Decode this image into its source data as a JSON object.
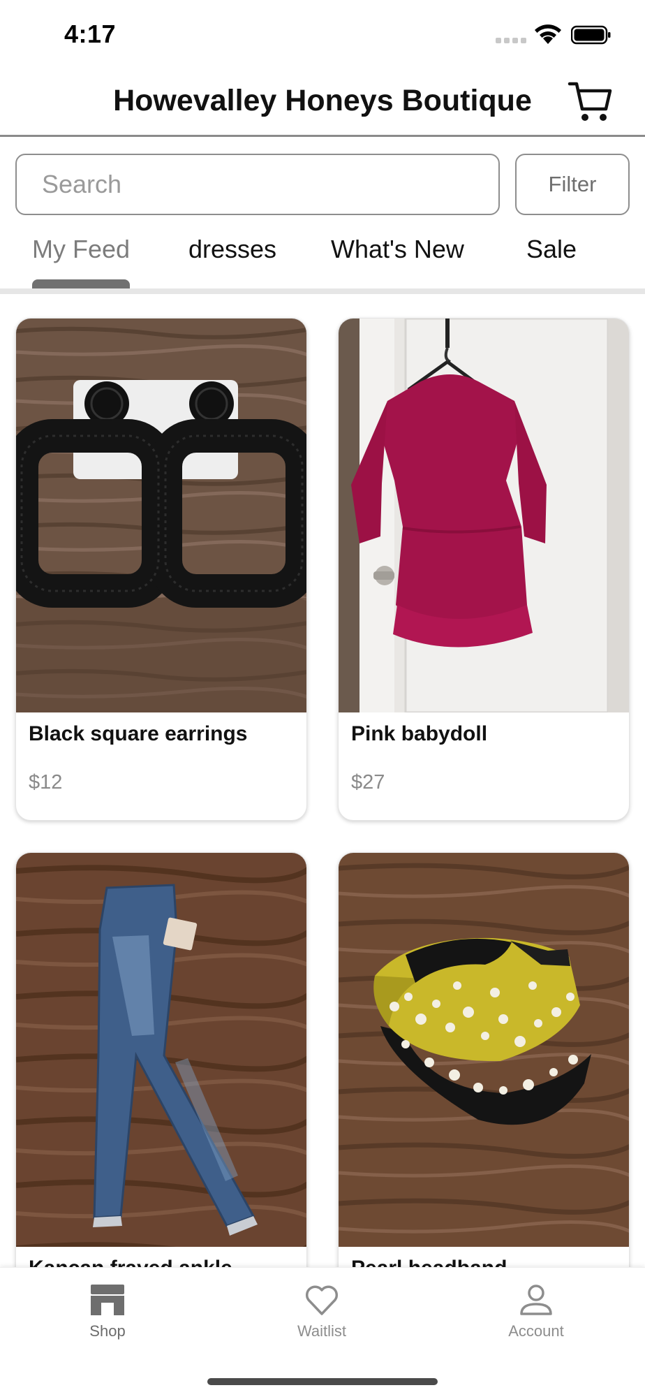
{
  "status": {
    "time": "4:17"
  },
  "header": {
    "title": "Howevalley Honeys Boutique",
    "cart_icon": "cart-icon"
  },
  "search": {
    "placeholder": "Search",
    "value": ""
  },
  "filter": {
    "label": "Filter"
  },
  "tabs": [
    {
      "label": "My Feed",
      "active": true
    },
    {
      "label": "dresses",
      "active": false
    },
    {
      "label": "What's New",
      "active": false
    },
    {
      "label": "Sale",
      "active": false
    }
  ],
  "products": [
    {
      "name": "Black square earrings",
      "price": "$12"
    },
    {
      "name": "Pink babydoll",
      "price": "$27"
    },
    {
      "name": "Kancan frayed ankle...",
      "price": ""
    },
    {
      "name": "Pearl headband",
      "price": ""
    }
  ],
  "bottom_nav": [
    {
      "label": "Shop",
      "icon": "store-icon",
      "active": true
    },
    {
      "label": "Waitlist",
      "icon": "heart-icon",
      "active": false
    },
    {
      "label": "Account",
      "icon": "person-icon",
      "active": false
    }
  ]
}
